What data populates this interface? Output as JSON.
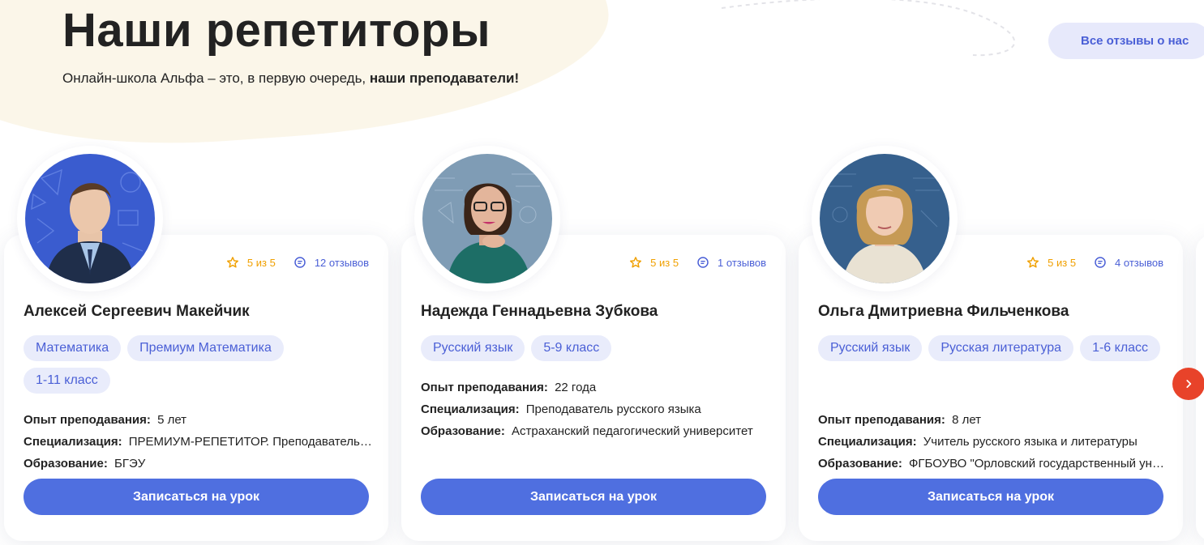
{
  "header": {
    "title": "Наши репетиторы",
    "subtitle_prefix": "Онлайн-школа Альфа – это, в первую очередь, ",
    "subtitle_bold": "наши преподаватели!",
    "reviews_button": "Все отзывы о нас"
  },
  "labels": {
    "experience": "Опыт преподавания:",
    "specialization": "Специализация:",
    "education": "Образование:",
    "book_button": "Записаться на урок"
  },
  "colors": {
    "accent": "#4f6fe0",
    "tag_bg": "#e9ecfb",
    "rating": "#f0a000",
    "next_arrow": "#e8432a"
  },
  "tutors": [
    {
      "name": "Алексей Сергеевич Макейчик",
      "rating": "5 из 5",
      "reviews": "12 отзывов",
      "tags": [
        "Математика",
        "Премиум Математика",
        "1-11 класс"
      ],
      "experience": "5 лет",
      "specialization": "ПРЕМИУМ-РЕПЕТИТОР. Преподаватель математики",
      "education": "БГЭУ"
    },
    {
      "name": "Надежда Геннадьевна Зубкова",
      "rating": "5 из 5",
      "reviews": "1 отзывов",
      "tags": [
        "Русский язык",
        "5-9 класс"
      ],
      "experience": "22 года",
      "specialization": "Преподаватель русского языка",
      "education": "Астраханский педагогический университет"
    },
    {
      "name": "Ольга Дмитриевна Фильченкова",
      "rating": "5 из 5",
      "reviews": "4 отзывов",
      "tags": [
        "Русский язык",
        "Русская литература",
        "1-6 класс"
      ],
      "experience": "8 лет",
      "specialization": "Учитель русского языка и литературы",
      "education": "ФГБОУВО \"Орловский государственный университет\""
    }
  ],
  "icons": {
    "rating": "star-icon",
    "reviews": "comment-icon",
    "next": "chevron-right-icon"
  }
}
